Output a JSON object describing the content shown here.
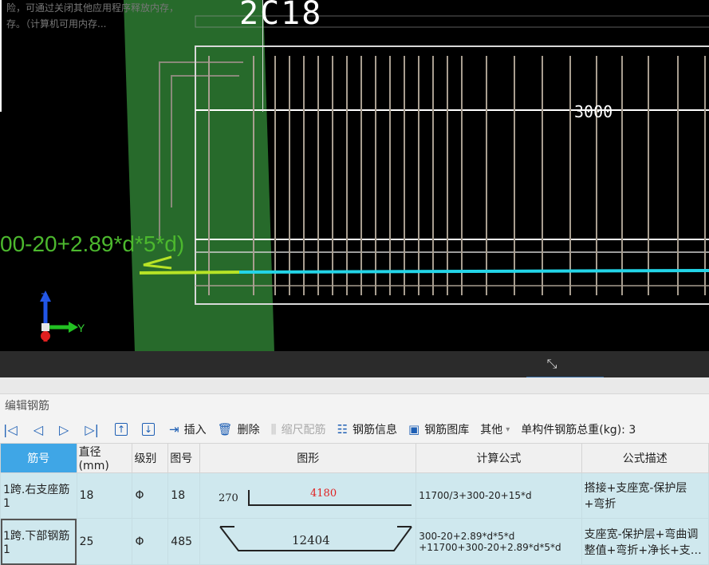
{
  "viewport": {
    "warning_lines": [
      "险，可通过关闭其他应用程序释放内存，",
      "存。（计算机可用内存..."
    ],
    "bar_label": "2C18",
    "dimension": "3000",
    "formula_overlay": "00-20+2.89*d*5*d)",
    "axis_z": "Z",
    "axis_y": "Y",
    "colors": {
      "green_band": "#2e7d32",
      "cyan_bar": "#23d5e8",
      "lime_bar": "#b7e326",
      "rebar": "#a89e90"
    }
  },
  "panel": {
    "title": "编辑钢筋",
    "toolbar": {
      "first": "|◁",
      "prev": "◁",
      "next": "▷",
      "last": "▷|",
      "up_icon": "↑",
      "down_icon": "↓",
      "insert": "插入",
      "delete": "删除",
      "scale": "缩尺配筋",
      "info": "钢筋信息",
      "library": "钢筋图库",
      "other": "其他",
      "other_caret": "▾",
      "total_weight": "单构件钢筋总重(kg): 3"
    },
    "columns": [
      "筋号",
      "直径(mm)",
      "级别",
      "图号",
      "图形",
      "计算公式",
      "公式描述"
    ],
    "rows": [
      {
        "name": "1跨.右支座筋1",
        "diameter": "18",
        "grade": "Φ",
        "fig_no": "18",
        "shape_left": "270",
        "shape_len": "4180",
        "formula": "11700/3+300-20+15*d",
        "desc": "搭接+支座宽-保护层+弯折"
      },
      {
        "name": "1跨.下部钢筋1",
        "diameter": "25",
        "grade": "Φ",
        "fig_no": "485",
        "shape_len": "12404",
        "formula": "300-20+2.89*d*5*d +11700+300-20+2.89*d*5*d",
        "desc": "支座宽-保护层+弯曲调整值+弯折+净长+支…"
      }
    ]
  }
}
